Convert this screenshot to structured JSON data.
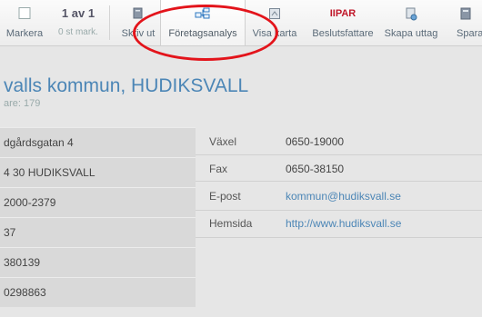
{
  "toolbar": {
    "mark_label": "Markera",
    "count_main": "1 av 1",
    "count_sub": "0 st mark.",
    "print_label": "Skriv ut",
    "analysis_label": "Företagsanalys",
    "map_label": "Visa karta",
    "par_logo": "IIPAR",
    "decision_label": "Beslutsfattare",
    "export_label": "Skapa uttag",
    "save_label": "Spara"
  },
  "company": {
    "title": "valls kommun, HUDIKSVALL",
    "subtitle": "are: 179"
  },
  "left_fields": [
    "dgårdsgatan 4",
    "4 30 HUDIKSVALL",
    "2000-2379",
    "37",
    "380139",
    "0298863"
  ],
  "right_fields": [
    {
      "label": "Växel",
      "value": "0650-19000"
    },
    {
      "label": "Fax",
      "value": "0650-38150"
    },
    {
      "label": "E-post",
      "value": "kommun@hudiksvall.se"
    },
    {
      "label": "Hemsida",
      "value": "http://www.hudiksvall.se"
    }
  ],
  "colors": {
    "accent": "#4c86b6",
    "highlight": "#e3141b"
  }
}
